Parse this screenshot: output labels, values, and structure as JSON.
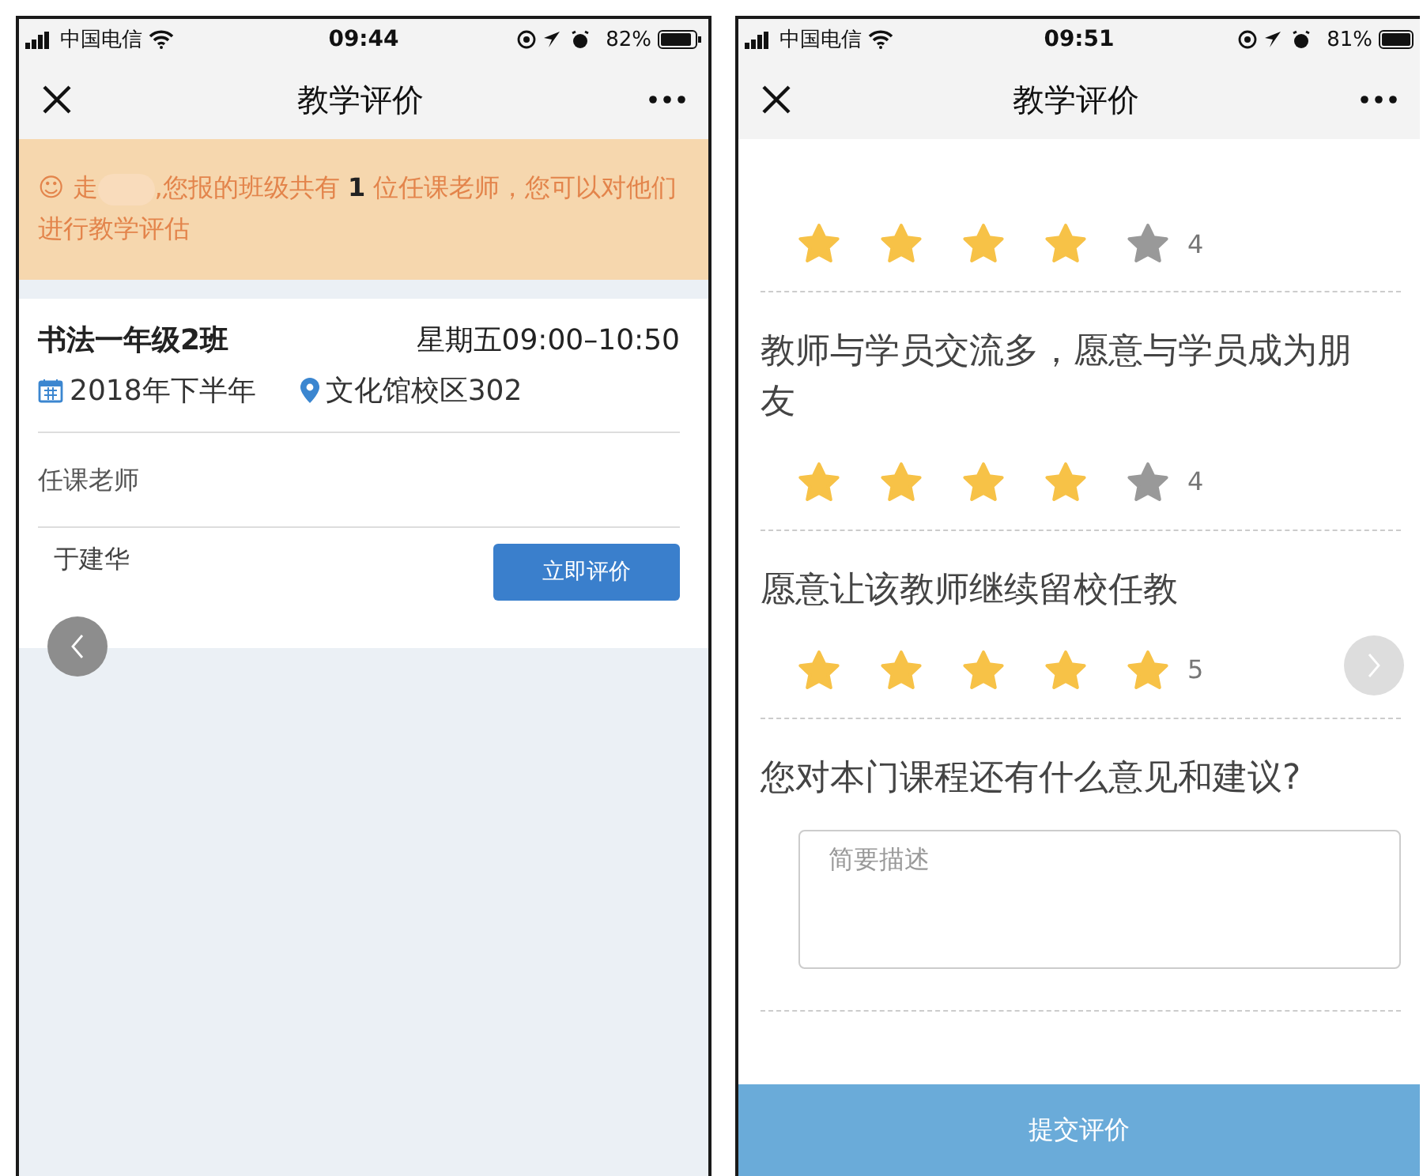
{
  "left_screen": {
    "status_bar": {
      "carrier": "中国电信",
      "time": "09:44",
      "battery": "82%"
    },
    "nav": {
      "title": "教学评价"
    },
    "notice": {
      "prefix": "☺ 走",
      "suffix": ",您报的班级共有 **1** 位任课老师，您可以对他们进行教学评估"
    },
    "class_card": {
      "name": "书法一年级2班",
      "schedule": "星期五09:00–10:50",
      "term": "2018年下半年",
      "location": "文化馆校区302",
      "section_label": "任课老师",
      "teachers": [
        {
          "name": "于建华",
          "button": "立即评价"
        }
      ]
    }
  },
  "right_screen": {
    "status_bar": {
      "carrier": "中国电信",
      "time": "09:51",
      "battery": "81%"
    },
    "nav": {
      "title": "教学评价"
    },
    "ratings": [
      {
        "stars": 4,
        "score": "4"
      },
      {
        "question": "教师与学员交流多，愿意与学员成为朋友",
        "stars": 4,
        "score": "4"
      },
      {
        "question": "愿意让该教师继续留校任教",
        "stars": 5,
        "score": "5"
      }
    ],
    "comment": {
      "question": "您对本门课程还有什么意见和建议?",
      "placeholder": "简要描述"
    },
    "submit": "提交评价"
  }
}
